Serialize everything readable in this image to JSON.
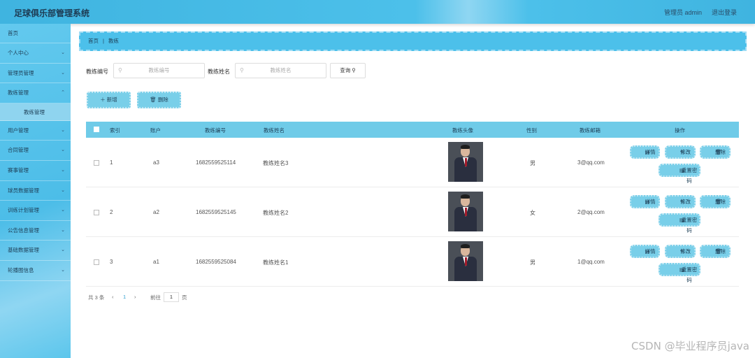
{
  "header": {
    "title": "足球俱乐部管理系统",
    "user": "管理员 admin",
    "logout": "退出登录"
  },
  "sidebar": {
    "home": "首页",
    "items": [
      "个人中心",
      "管理员管理",
      "教练管理",
      "用户管理",
      "合同管理",
      "赛事管理",
      "球员数据管理",
      "训练计划管理",
      "公告信息管理",
      "基础数据管理",
      "轮播图信息"
    ],
    "active_sub": "教练管理"
  },
  "breadcrumb": {
    "home": "首页",
    "current": "教练"
  },
  "search": {
    "label_no": "教练编号",
    "placeholder_no": "教练编号",
    "label_name": "教练姓名",
    "placeholder_name": "教练姓名",
    "button": "查询"
  },
  "actions": {
    "add": "新增",
    "delete": "删除"
  },
  "table": {
    "headers": {
      "index": "索引",
      "account": "账户",
      "no": "教练编号",
      "name": "教练姓名",
      "avatar": "教练头像",
      "gender": "性别",
      "email": "教练邮箱",
      "ops": "操作"
    },
    "rows": [
      {
        "index": "1",
        "account": "a3",
        "no": "1682559525114",
        "name": "教练姓名3",
        "gender": "男",
        "email": "3@qq.com"
      },
      {
        "index": "2",
        "account": "a2",
        "no": "1682559525145",
        "name": "教练姓名2",
        "gender": "女",
        "email": "2@qq.com"
      },
      {
        "index": "3",
        "account": "a1",
        "no": "1682559525084",
        "name": "教练姓名1",
        "gender": "男",
        "email": "1@qq.com"
      }
    ],
    "ops": {
      "detail": "详情",
      "edit": "修改",
      "delete": "删除",
      "reset": "重置密码"
    }
  },
  "pager": {
    "total": "共 3 条",
    "current": "1",
    "goto": "前往",
    "goto_value": "1",
    "page": "页"
  },
  "watermark": "CSDN @毕业程序员java"
}
